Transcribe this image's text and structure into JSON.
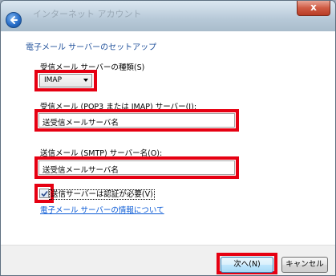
{
  "window": {
    "title": "インターネット アカウント"
  },
  "titlebar": {
    "close_glyph": "x"
  },
  "main": {
    "heading": "電子メール サーバーのセットアップ",
    "server_type": {
      "label": "受信メール サーバーの種類(S)",
      "selected": "IMAP"
    },
    "incoming": {
      "label": "受信メール (POP3 または IMAP) サーバー(I):",
      "value": "送受信メールサーバ名"
    },
    "outgoing": {
      "label": "送信メール (SMTP) サーバー名(O):",
      "value": "送受信メールサーバ名"
    },
    "auth": {
      "label": "送信サーバーは認証が必要(V)",
      "checked": true
    },
    "info_link": "電子メール サーバーの情報について"
  },
  "footer": {
    "next_label": "次へ(N)",
    "cancel_label": "キャンセル"
  },
  "colors": {
    "highlight": "#e60012",
    "heading": "#1e4f9a",
    "link": "#0b5bd6"
  }
}
